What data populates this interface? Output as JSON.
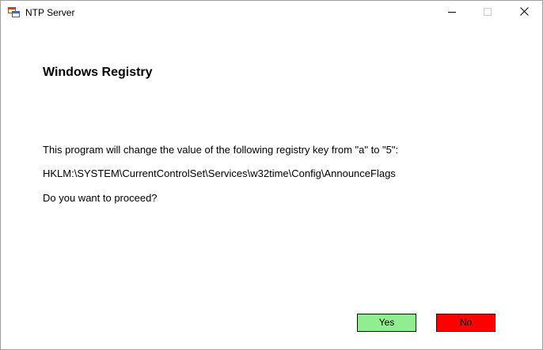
{
  "window": {
    "title": "NTP Server",
    "icon": "app-window-icon"
  },
  "titlebar_controls": {
    "minimize_icon": "minimize-icon",
    "maximize_icon": "maximize-icon",
    "close_icon": "close-icon"
  },
  "content": {
    "heading": "Windows Registry",
    "message_line_1": "This program will change the value of the following registry key from \"a\" to \"5\":",
    "registry_path": "HKLM:\\SYSTEM\\CurrentControlSet\\Services\\w32time\\Config\\AnnounceFlags",
    "question": "Do you want to proceed?"
  },
  "buttons": {
    "yes_label": "Yes",
    "no_label": "No",
    "yes_color": "#90EE90",
    "no_color": "#FF0000"
  }
}
